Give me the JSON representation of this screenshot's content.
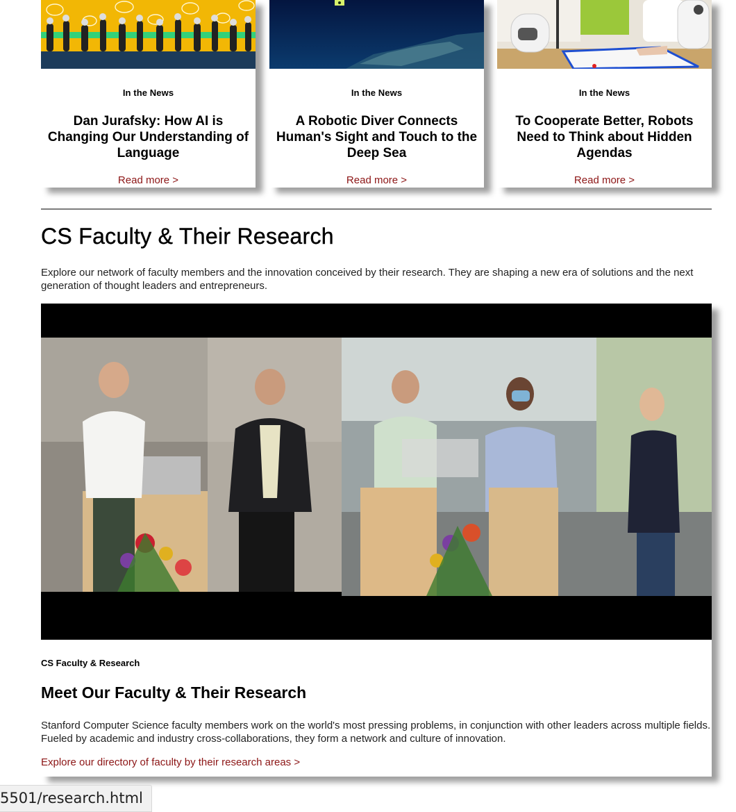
{
  "news": [
    {
      "category": "In the News",
      "title": "Dan Jurafsky: How AI is Changing Our Understanding of Language",
      "link": "Read more >"
    },
    {
      "category": "In the News",
      "title": "A Robotic Diver Connects Human's Sight and Touch to the Deep Sea",
      "link": "Read more >"
    },
    {
      "category": "In the News",
      "title": "To Cooperate Better, Robots Need to Think about Hidden Agendas",
      "link": "Read more >"
    }
  ],
  "section": {
    "title": "CS Faculty & Their Research",
    "intro": "Explore our network of faculty members and the innovation conceived by their research. They are shaping a new era of solutions and the next generation of thought leaders and entrepreneurs."
  },
  "feature": {
    "eyebrow": "CS Faculty & Research",
    "title": "Meet Our Faculty & Their Research",
    "body": "Stanford Computer Science faculty members work on the world's most pressing problems, in conjunction with other leaders across multiple fields. Fueled by academic and industry cross-collaborations, they form a network and culture of innovation.",
    "link": "Explore our directory of faculty by their research areas >"
  },
  "status_bar": {
    "url": "5501/research.html"
  },
  "colors": {
    "link": "#8c1515",
    "divider": "#7d7d7d",
    "news_band": "#f5c518"
  }
}
